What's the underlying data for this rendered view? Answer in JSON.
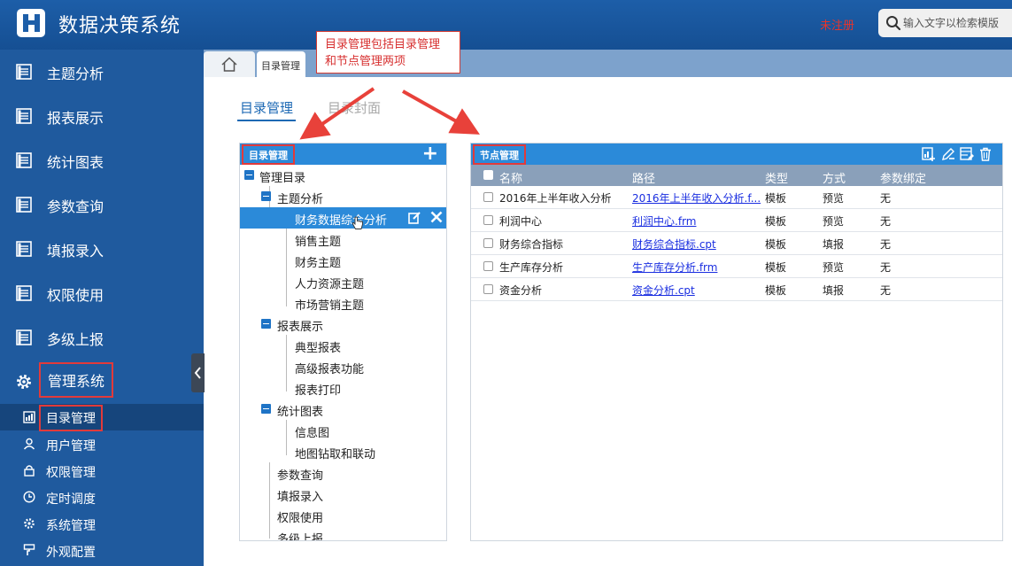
{
  "header": {
    "app_title": "数据决策系统",
    "unregistered": "未注册",
    "search_placeholder": "输入文字以检索模版",
    "brand_color": "#1d5ea8"
  },
  "sidebar": {
    "items": [
      {
        "label": "主题分析",
        "icon": "report-icon"
      },
      {
        "label": "报表展示",
        "icon": "report-icon"
      },
      {
        "label": "统计图表",
        "icon": "report-icon"
      },
      {
        "label": "参数查询",
        "icon": "report-icon"
      },
      {
        "label": "填报录入",
        "icon": "report-icon"
      },
      {
        "label": "权限使用",
        "icon": "report-icon"
      },
      {
        "label": "多级上报",
        "icon": "report-icon"
      },
      {
        "label": "管理系统",
        "icon": "gear-icon"
      }
    ],
    "subitems": [
      {
        "label": "目录管理",
        "icon": "catalog-icon",
        "active": true
      },
      {
        "label": "用户管理",
        "icon": "user-icon"
      },
      {
        "label": "权限管理",
        "icon": "lock-icon"
      },
      {
        "label": "定时调度",
        "icon": "clock-icon"
      },
      {
        "label": "系统管理",
        "icon": "gear-icon"
      },
      {
        "label": "外观配置",
        "icon": "brush-icon"
      }
    ]
  },
  "tabbar": {
    "home_icon": "home-icon",
    "active_tab": "目录管理"
  },
  "callout": {
    "line1": "目录管理包括目录管理",
    "line2": "和节点管理两项"
  },
  "content_tabs": [
    "目录管理",
    "目录封面"
  ],
  "tree_panel": {
    "title": "目录管理",
    "add_label": "+",
    "nodes": [
      {
        "label": "管理目录"
      },
      {
        "label": "主题分析"
      },
      {
        "label": "财务数据综合分析"
      },
      {
        "label": "销售主题"
      },
      {
        "label": "财务主题"
      },
      {
        "label": "人力资源主题"
      },
      {
        "label": "市场营销主题"
      },
      {
        "label": "报表展示"
      },
      {
        "label": "典型报表"
      },
      {
        "label": "高级报表功能"
      },
      {
        "label": "报表打印"
      },
      {
        "label": "统计图表"
      },
      {
        "label": "信息图"
      },
      {
        "label": "地图钻取和联动"
      },
      {
        "label": "参数查询"
      },
      {
        "label": "填报录入"
      },
      {
        "label": "权限使用"
      },
      {
        "label": "多级上报"
      }
    ]
  },
  "node_panel": {
    "title": "节点管理",
    "toolbar_icons": [
      "add-report-icon",
      "edit-link-icon",
      "edit-table-icon",
      "trash-icon"
    ],
    "columns": [
      "名称",
      "路径",
      "类型",
      "方式",
      "参数绑定"
    ],
    "rows": [
      {
        "name": "2016年上半年收入分析",
        "path": "2016年上半年收入分析.f...",
        "type": "模板",
        "mode": "预览",
        "param": "无"
      },
      {
        "name": "利润中心",
        "path": "利润中心.frm",
        "type": "模板",
        "mode": "预览",
        "param": "无"
      },
      {
        "name": "财务综合指标",
        "path": "财务综合指标.cpt",
        "type": "模板",
        "mode": "填报",
        "param": "无"
      },
      {
        "name": "生产库存分析",
        "path": "生产库存分析.frm",
        "type": "模板",
        "mode": "预览",
        "param": "无"
      },
      {
        "name": "资金分析",
        "path": "资金分析.cpt",
        "type": "模板",
        "mode": "填报",
        "param": "无"
      }
    ]
  }
}
